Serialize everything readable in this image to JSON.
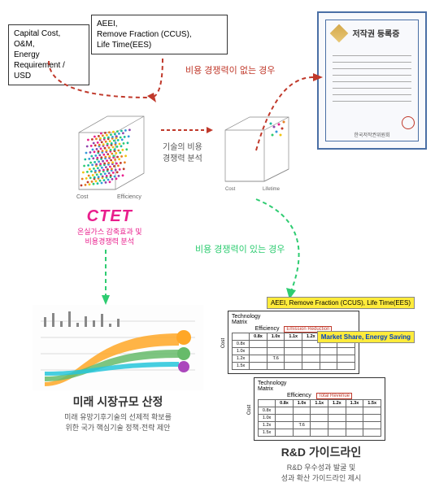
{
  "inputs": {
    "box1_l1": "Capital Cost,",
    "box1_l2": "O&M,",
    "box1_l3": "Energy Requirement / USD",
    "box2_l1": "AEEI,",
    "box2_l2": "Remove Fraction (CCUS),",
    "box2_l3": "Life Time(EES)"
  },
  "certificate": {
    "title": "저작권 등록증",
    "footer": "한국저작권위원회"
  },
  "flow_labels": {
    "no_cost_comp": "비용 경쟁력이 없는 경우",
    "has_cost_comp": "비용 경쟁력이 있는 경우"
  },
  "cube": {
    "axis_x": "Cost",
    "axis_y": "Efficiency",
    "annot_l1": "기술의 비용",
    "annot_l2": "경쟁력 분석",
    "axis2_x": "Cost",
    "axis2_y": "Lifetime"
  },
  "ctet": {
    "title": "CTET",
    "sub_l1": "온실가스 감축효과 및",
    "sub_l2": "비용경쟁력 분석"
  },
  "yellow_tags": {
    "tag1": "AEEI, Remove Fraction (CCUS), Life Time(EES)",
    "tag2": "Market Share, Energy Saving"
  },
  "matrix": {
    "tech_label": "Technology",
    "matrix_label": "Matrix",
    "eff_label": "Efficiency",
    "cost_label": "Cost",
    "red1": "Emission Reduction",
    "red2": "Total Revenue",
    "cols": [
      "0.8x",
      "1.0x",
      "1.1x",
      "1.2x",
      "1.3x",
      "1.5x"
    ],
    "rows": [
      "0.8x",
      "1.0x",
      "1.2x",
      "1.5x"
    ],
    "sample_val": "T.6"
  },
  "bottom_left": {
    "title": "미래 시장규모 산정",
    "sub_l1": "미래 유망기후기술의 선제적 확보를",
    "sub_l2": "위한 국가 핵심기술 정책·전략 제안"
  },
  "bottom_right": {
    "title": "R&D 가이드라인",
    "sub_l1": "R&D 우수성과 발굴 및",
    "sub_l2": "성과 확산 가이드라인 제시"
  }
}
